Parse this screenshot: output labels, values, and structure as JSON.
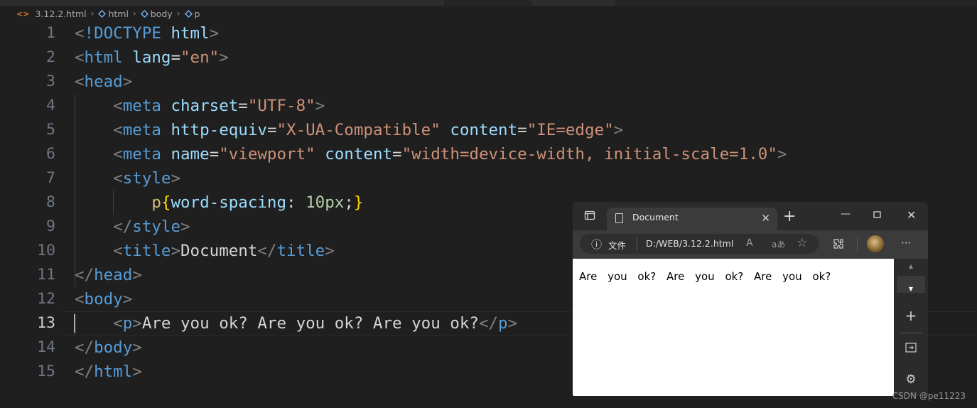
{
  "breadcrumb": {
    "file_icon": "html-file-icon",
    "items": [
      "3.12.2.html",
      "html",
      "body",
      "p"
    ]
  },
  "editor": {
    "line_numbers": [
      "1",
      "2",
      "3",
      "4",
      "5",
      "6",
      "7",
      "8",
      "9",
      "10",
      "11",
      "12",
      "13",
      "14",
      "15"
    ],
    "active_line": "13",
    "code": {
      "l1": {
        "open": "<",
        "doctype": "!DOCTYPE",
        "html": "html",
        "close": ">"
      },
      "l2": {
        "open": "<",
        "tag": "html",
        "attr": "lang",
        "eq": "=",
        "val": "\"en\"",
        "close": ">"
      },
      "l3": {
        "open": "<",
        "tag": "head",
        "close": ">"
      },
      "l4": {
        "open": "<",
        "tag": "meta",
        "attr": "charset",
        "eq": "=",
        "val": "\"UTF-8\"",
        "close": ">"
      },
      "l5": {
        "open": "<",
        "tag": "meta",
        "attr1": "http-equiv",
        "eq1": "=",
        "val1": "\"X-UA-Compatible\"",
        "attr2": "content",
        "eq2": "=",
        "val2": "\"IE=edge\"",
        "close": ">"
      },
      "l6": {
        "open": "<",
        "tag": "meta",
        "attr1": "name",
        "eq1": "=",
        "val1": "\"viewport\"",
        "attr2": "content",
        "eq2": "=",
        "val2": "\"width=device-width, initial-scale=1.0\"",
        "close": ">"
      },
      "l7": {
        "open": "<",
        "tag": "style",
        "close": ">"
      },
      "l8": {
        "selector": "p",
        "lbrace": "{",
        "prop": "word-spacing",
        "colon": ": ",
        "value": "10px",
        "semi": ";",
        "rbrace": "}"
      },
      "l9": {
        "open": "</",
        "tag": "style",
        "close": ">"
      },
      "l10": {
        "open": "<",
        "tag": "title",
        "close": ">",
        "text": "Document",
        "open2": "</",
        "tag2": "title",
        "close2": ">"
      },
      "l11": {
        "open": "</",
        "tag": "head",
        "close": ">"
      },
      "l12": {
        "open": "<",
        "tag": "body",
        "close": ">"
      },
      "l13": {
        "open": "<",
        "tag": "p",
        "close": ">",
        "text": "Are you ok? Are you ok? Are you ok?",
        "open2": "</",
        "tag2": "p",
        "close2": ">"
      },
      "l14": {
        "open": "</",
        "tag": "body",
        "close": ">"
      },
      "l15": {
        "open": "</",
        "tag": "html",
        "close": ">"
      }
    }
  },
  "browser": {
    "tab_title": "Document",
    "tab_close": "✕",
    "new_tab": "+",
    "minimize": "—",
    "maximize": "☐",
    "close": "✕",
    "info_icon": "ⓘ",
    "site_label": "文件",
    "url": "D:/WEB/3.12.2.html",
    "read_aloud": "A",
    "translate": "aあ",
    "favorite": "☆",
    "menu": "···",
    "content_text": "Are you ok? Are you ok? Are you ok?",
    "sidebar": {
      "scroll_up": "▲",
      "scroll_down": "▼",
      "add": "+",
      "split": "⇥",
      "settings": "⚙"
    }
  },
  "watermark": "CSDN @pe11223"
}
